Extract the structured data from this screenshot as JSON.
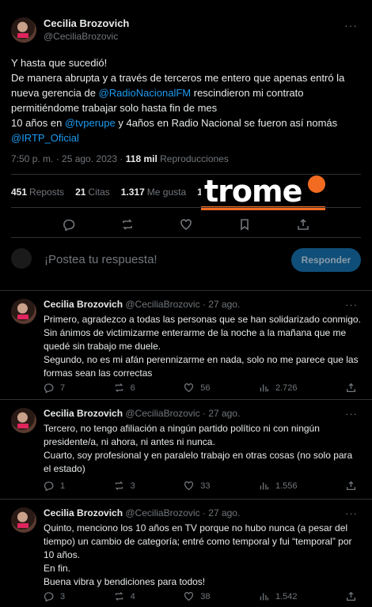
{
  "post": {
    "author_name": "Cecilia Brozovich",
    "author_handle": "@CeciliaBrozovic",
    "more": "···",
    "lines": [
      "Y hasta que sucedió!",
      "De manera abrupta y a través de terceros me entero que apenas entró la",
      [
        "nueva gerencia de ",
        "@RadioNacionalFM",
        " rescindieron mi contrato"
      ],
      "permitiéndome trabajar solo hasta fin de mes",
      [
        "10 años en ",
        "@tvperupe",
        " y 4años en Radio Nacional se fueron así nomás"
      ],
      [
        "",
        "@IRTP_Oficial",
        ""
      ]
    ],
    "time": "7:50 p. m. · 25 ago. 2023 · ",
    "views_count": "118 mil",
    "views_label": " Reproducciones",
    "stats": [
      {
        "count": "451",
        "label": "Reposts"
      },
      {
        "count": "21",
        "label": "Citas"
      },
      {
        "count": "1.317",
        "label": "Me gusta"
      },
      {
        "count": "13",
        "label": ""
      }
    ],
    "reply_placeholder": "¡Postea tu respuesta!",
    "reply_button": "Responder"
  },
  "watermark": {
    "text": "trome",
    "color": "#f26b21"
  },
  "replies": [
    {
      "name": "Cecilia Brozovich",
      "handle": "@CeciliaBrozovic",
      "date": "· 27 ago.",
      "lines": [
        "Primero, agradezco a todas las personas que se han solidarizado conmigo.",
        "Sin ánimos de victimizarme enterarme de la noche a la mañana que me",
        "quedé sin trabajo me duele.",
        "Segundo, no es mi afán perennizarme en nada, solo no me parece que las",
        "formas sean las correctas"
      ],
      "replies": "7",
      "reposts": "6",
      "likes": "56",
      "views": "2.726"
    },
    {
      "name": "Cecilia Brozovich",
      "handle": "@CeciliaBrozovic",
      "date": "· 27 ago.",
      "lines": [
        "Tercero, no tengo afiliación a ningún partido político ni con ningún",
        "presidente/a, ni ahora, ni antes ni nunca.",
        "Cuarto, soy profesional y en paralelo trabajo en otras cosas (no solo para",
        "el estado)"
      ],
      "replies": "1",
      "reposts": "3",
      "likes": "33",
      "views": "1.556"
    },
    {
      "name": "Cecilia Brozovich",
      "handle": "@CeciliaBrozovic",
      "date": "· 27 ago.",
      "lines": [
        "Quinto, menciono los 10 años en TV porque no hubo nunca (a pesar del",
        "tiempo) un cambio de categoría; entré como temporal y fui “temporal” por",
        "10 años.",
        "En fin.",
        "Buena vibra y bendiciones para todos!"
      ],
      "replies": "3",
      "reposts": "4",
      "likes": "38",
      "views": "1.542"
    }
  ]
}
